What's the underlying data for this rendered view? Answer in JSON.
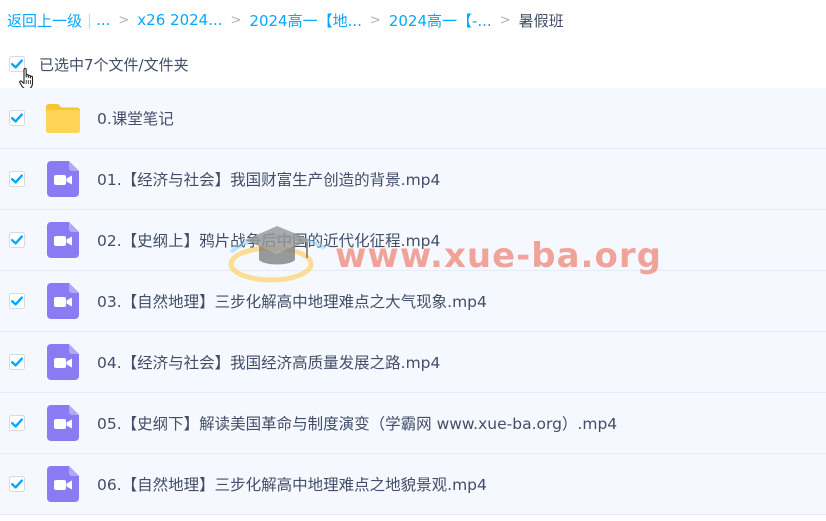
{
  "breadcrumb": {
    "back": "返回上一级",
    "ellipsis": "...",
    "items": [
      "x26 2024...",
      "2024高一【地...",
      "2024高一【-..."
    ],
    "current": "暑假班"
  },
  "selection": {
    "text": "已选中7个文件/文件夹"
  },
  "files": [
    {
      "name": "0.课堂笔记",
      "type": "folder"
    },
    {
      "name": "01.【经济与社会】我国财富生产创造的背景.mp4",
      "type": "video"
    },
    {
      "name": "02.【史纲上】鸦片战争后中国的近代化征程.mp4",
      "type": "video"
    },
    {
      "name": "03.【自然地理】三步化解高中地理难点之大气现象.mp4",
      "type": "video"
    },
    {
      "name": "04.【经济与社会】我国经济高质量发展之路.mp4",
      "type": "video"
    },
    {
      "name": "05.【史纲下】解读美国革命与制度演变（学霸网 www.xue-ba.org）.mp4",
      "type": "video"
    },
    {
      "name": "06.【自然地理】三步化解高中地理难点之地貌景观.mp4",
      "type": "video"
    }
  ],
  "watermark": {
    "text": "www.xue-ba.org"
  },
  "colors": {
    "link": "#06a7ff",
    "check": "#06a7ff",
    "folder": "#ffd04b",
    "video": "#8b7bf2",
    "row_bg": "#f5f9ff"
  }
}
